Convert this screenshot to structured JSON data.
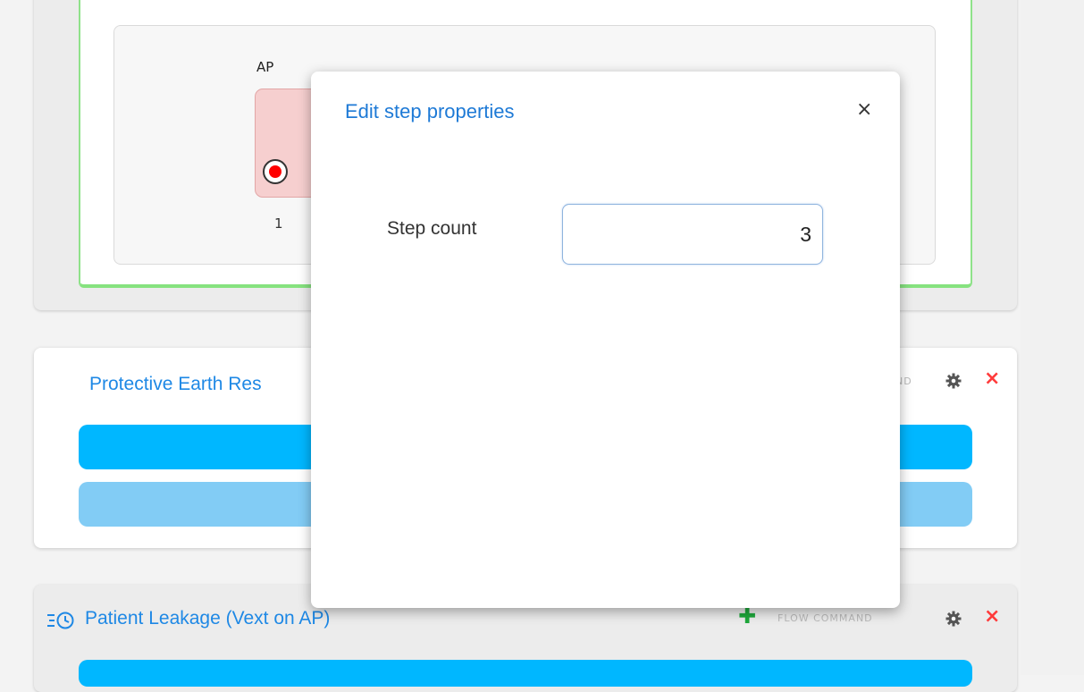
{
  "top_card": {
    "ap_label": "AP",
    "step_number": "1"
  },
  "middle_card": {
    "title": "Protective Earth Res",
    "command_label": "ND"
  },
  "bottom_card": {
    "title": "Patient Leakage (Vext on AP)",
    "command_label": "FLOW COMMAND"
  },
  "modal": {
    "title": "Edit step properties",
    "close_glyph": "×",
    "step_count_label": "Step count",
    "step_count_value": "3"
  },
  "glyphs": {
    "close": "×",
    "plus": "✚"
  },
  "colors": {
    "accent_blue": "#1e88e5",
    "bar_blue": "#00b7ff",
    "bar_light_blue": "#82ccf5",
    "active_green": "#86e27f",
    "delete_red": "#ff3b3b",
    "add_green": "#1ea83b"
  }
}
